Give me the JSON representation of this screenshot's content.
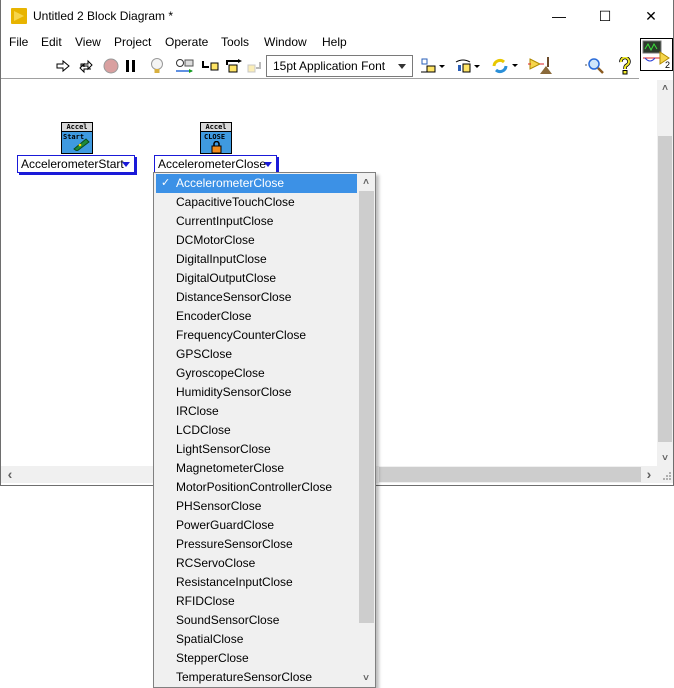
{
  "window": {
    "title": "Untitled 2 Block Diagram *",
    "controls": {
      "minimize": "—",
      "maximize": "☐",
      "close": "✕"
    }
  },
  "menu": {
    "items": [
      "File",
      "Edit",
      "View",
      "Project",
      "Operate",
      "Tools",
      "Window",
      "Help"
    ]
  },
  "toolbar": {
    "font_select": "15pt Application Font",
    "icons": [
      "run-arrow-icon",
      "run-continuously-icon",
      "abort-icon",
      "pause-icon",
      "highlight-execution-icon",
      "retain-wire-values-icon",
      "step-into-icon",
      "step-over-icon",
      "step-out-icon",
      "align-objects-icon",
      "distribute-objects-icon",
      "reorder-icon",
      "clean-up-diagram-icon",
      "search-icon",
      "context-help-icon"
    ],
    "connector_pane_label": "2"
  },
  "diagram": {
    "nodes": [
      {
        "icon_header": "Accel",
        "icon_sub": "Start",
        "ring_value": "AccelerometerStart"
      },
      {
        "icon_header": "Accel",
        "icon_sub": "CLOSE",
        "ring_value": "AccelerometerClose"
      }
    ]
  },
  "dropdown": {
    "selected": "AccelerometerClose",
    "check": "✓",
    "items": [
      "AccelerometerClose",
      "CapacitiveTouchClose",
      "CurrentInputClose",
      "DCMotorClose",
      "DigitalInputClose",
      "DigitalOutputClose",
      "DistanceSensorClose",
      "EncoderClose",
      "FrequencyCounterClose",
      "GPSClose",
      "GyroscopeClose",
      "HumiditySensorClose",
      "IRClose",
      "LCDClose",
      "LightSensorClose",
      "MagnetometerClose",
      "MotorPositionControllerClose",
      "PHSensorClose",
      "PowerGuardClose",
      "PressureSensorClose",
      "RCServoClose",
      "ResistanceInputClose",
      "RFIDClose",
      "SoundSensorClose",
      "SpatialClose",
      "StepperClose",
      "TemperatureSensorClose"
    ]
  },
  "scroll": {
    "up": "˄",
    "down": "˅",
    "left": "‹",
    "right": "›"
  }
}
